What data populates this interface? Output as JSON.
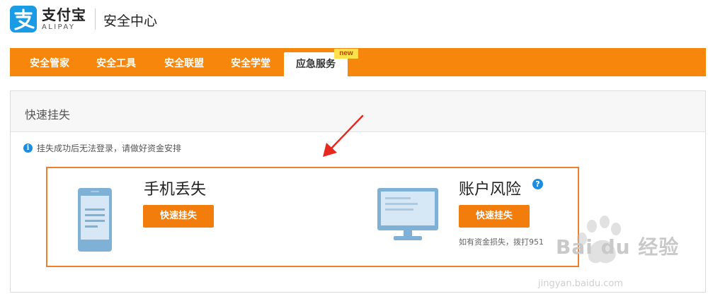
{
  "brand": {
    "logo_cn": "支付宝",
    "logo_en": "ALIPAY",
    "site_title": "安全中心",
    "logo_color": "#1a9be6"
  },
  "nav": {
    "color": "#f7860d",
    "items": [
      {
        "label": "安全管家"
      },
      {
        "label": "安全工具"
      },
      {
        "label": "安全联盟"
      },
      {
        "label": "安全学堂"
      },
      {
        "label": "应急服务",
        "active": true
      }
    ],
    "badge": "new"
  },
  "panel": {
    "title": "快速挂失",
    "notice": "挂失成功后无法登录，请做好资金安排",
    "cards": [
      {
        "title": "手机丢失",
        "button": "快速挂失",
        "icon": "phone-icon"
      },
      {
        "title": "账户风险",
        "button": "快速挂失",
        "icon": "monitor-icon",
        "note": "如有资金损失，拨打951"
      }
    ]
  },
  "watermark": {
    "brand": "Bai du 经验",
    "url": "jingyan.baidu.com"
  }
}
